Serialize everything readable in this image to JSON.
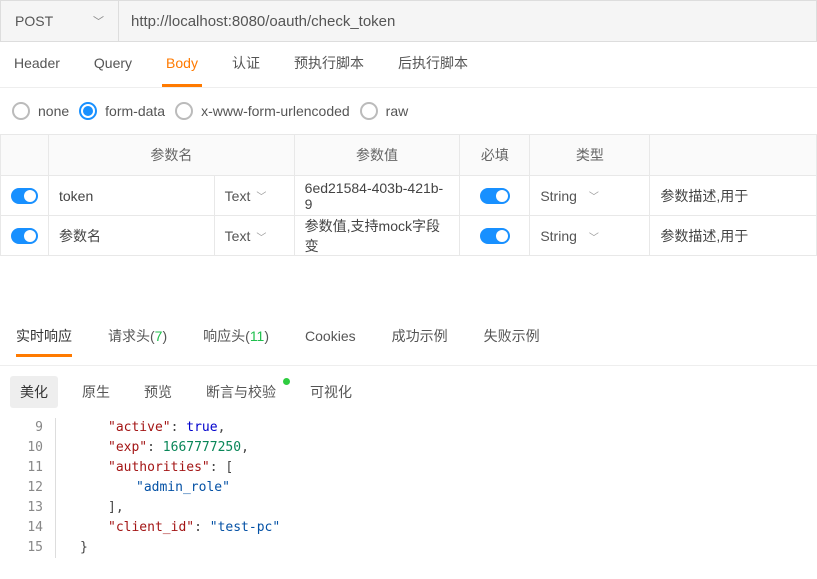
{
  "request": {
    "method": "POST",
    "url": "http://localhost:8080/oauth/check_token"
  },
  "req_tabs": [
    "Header",
    "Query",
    "Body",
    "认证",
    "预执行脚本",
    "后执行脚本"
  ],
  "req_tab_active": "Body",
  "body_types": [
    "none",
    "form-data",
    "x-www-form-urlencoded",
    "raw"
  ],
  "body_type_active": "form-data",
  "param_headers": {
    "name": "参数名",
    "value": "参数值",
    "required": "必填",
    "type": "类型"
  },
  "params": [
    {
      "enabled": true,
      "name": "token",
      "name_is_ph": false,
      "text_type": "Text",
      "value": "6ed21584-403b-421b-9",
      "value_is_ph": false,
      "required": true,
      "type": "String",
      "desc": "参数描述,用于"
    },
    {
      "enabled": true,
      "name": "参数名",
      "name_is_ph": true,
      "text_type": "Text",
      "value": "参数值,支持mock字段变",
      "value_is_ph": true,
      "required": true,
      "type": "String",
      "desc": "参数描述,用于"
    }
  ],
  "resp_tabs": {
    "realtime": "实时响应",
    "req_headers": "请求头",
    "req_headers_count": "7",
    "resp_headers": "响应头",
    "resp_headers_count": "11",
    "cookies": "Cookies",
    "success": "成功示例",
    "fail": "失败示例"
  },
  "fmt_tabs": [
    "美化",
    "原生",
    "预览",
    "断言与校验",
    "可视化"
  ],
  "fmt_tab_active": "美化",
  "code_start_line": 9,
  "response_json": {
    "active": true,
    "exp": 1667777250,
    "authorities": [
      "admin_role"
    ],
    "client_id": "test-pc"
  }
}
